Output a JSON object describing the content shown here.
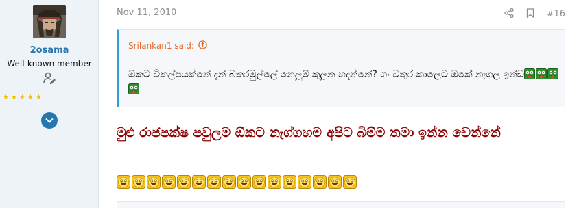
{
  "user": {
    "name": "2osama",
    "title": "Well-known member",
    "stars": 5
  },
  "post": {
    "date": "Nov 11, 2010",
    "number": "#16"
  },
  "quote": {
    "author": "Srilankan1 said:",
    "text": "ඕකට විකල්පයක්නේ දැන් බතරමුල්ලේ නෙලුම් කුලුන හදන්නේ? ගං වතුර කාලෙට ඔකේ නැගල ඉන්ඩ",
    "emoji_count": 4
  },
  "message": {
    "text": "මුළු රාජපක්ෂ පවුලම ඕකට නැග්ගහම අපිට බිම්ම තමා ඉන්න වෙන්නේ",
    "smiley_count": 16
  },
  "colors": {
    "accent": "#2577b1",
    "quote_author": "#e06a2d",
    "message_text": "#8b0000"
  }
}
